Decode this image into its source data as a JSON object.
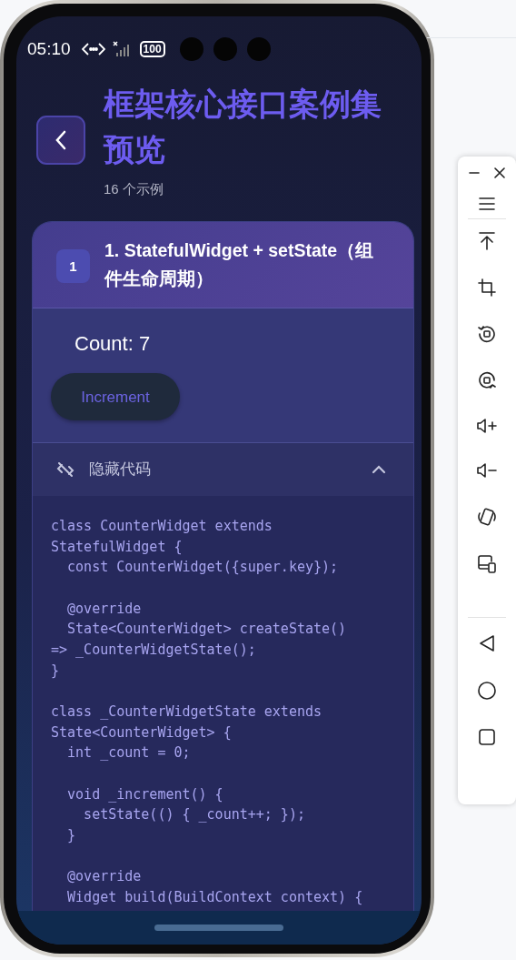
{
  "status_bar": {
    "time": "05:10",
    "battery": "100"
  },
  "header": {
    "title": "框架核心接口案例集预览",
    "subtitle": "16 个示例"
  },
  "examples": [
    {
      "number": "1",
      "title": "1. StatefulWidget + setState（组件生命周期）",
      "counter_text": "Count: 7",
      "button": "Increment",
      "code_toggle": "隐藏代码",
      "code_expanded": true,
      "code": "class CounterWidget extends\nStatefulWidget {\n  const CounterWidget({super.key});\n\n  @override\n  State<CounterWidget> createState()\n=> _CounterWidgetState();\n}\n\nclass _CounterWidgetState extends\nState<CounterWidget> {\n  int _count = 0;\n\n  void _increment() {\n    setState(() { _count++; });\n  }\n\n  @override\n  Widget build(BuildContext context) {"
    }
  ]
}
